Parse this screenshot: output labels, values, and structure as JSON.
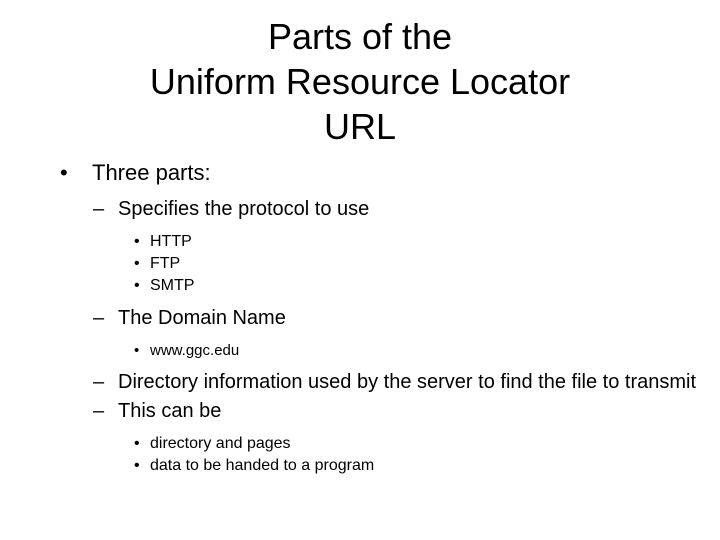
{
  "slide": {
    "background_color": "#ffffff",
    "text_color": "#000000",
    "title": {
      "line1": "Parts of the",
      "line2": "Uniform Resource Locator",
      "line3": "URL"
    },
    "markers": {
      "level1": "•",
      "level2": "–",
      "level3": "•"
    },
    "outline": {
      "item1": "Three parts:",
      "item1_sub1": "Specifies the protocol to use",
      "item1_sub1_a": "HTTP",
      "item1_sub1_b": "FTP",
      "item1_sub1_c": "SMTP",
      "item1_sub2": "The Domain Name",
      "item1_sub2_a": "www.ggc.edu",
      "item1_sub3": "Directory information used by the server to find the file to transmit",
      "item1_sub4": "This can be",
      "item1_sub4_a": "directory and pages",
      "item1_sub4_b": "data to be handed to a program"
    }
  }
}
